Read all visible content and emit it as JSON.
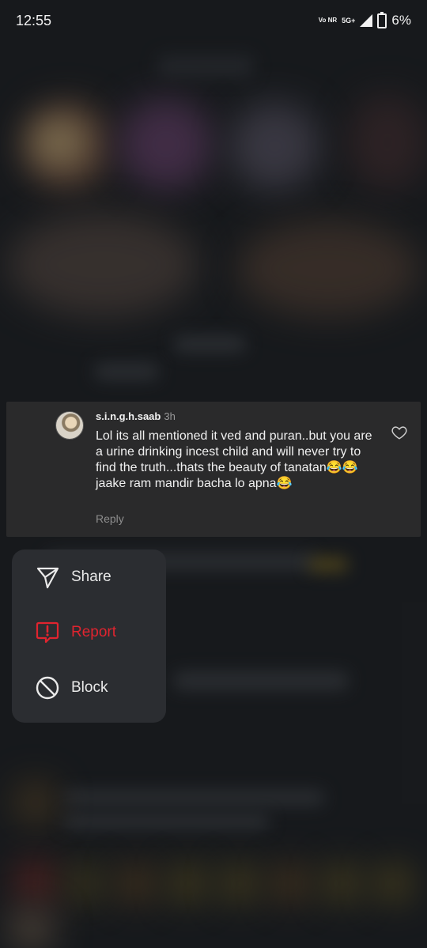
{
  "status_bar": {
    "time": "12:55",
    "volte": "Vo NR",
    "network": "5G+",
    "battery": "6%"
  },
  "comment": {
    "username": "s.i.n.g.h.saab",
    "time_ago": "3h",
    "text": "Lol its all mentioned it ved and puran..but you are a urine drinking incest child and will never try to find the truth...thats the beauty of tanatan😂😂 jaake ram mandir bacha lo apna😂",
    "reply_label": "Reply"
  },
  "menu": {
    "items": [
      {
        "label": "Share",
        "icon": "send-icon"
      },
      {
        "label": "Report",
        "icon": "report-icon",
        "color": "#e0242f"
      },
      {
        "label": "Block",
        "icon": "block-icon"
      }
    ]
  }
}
